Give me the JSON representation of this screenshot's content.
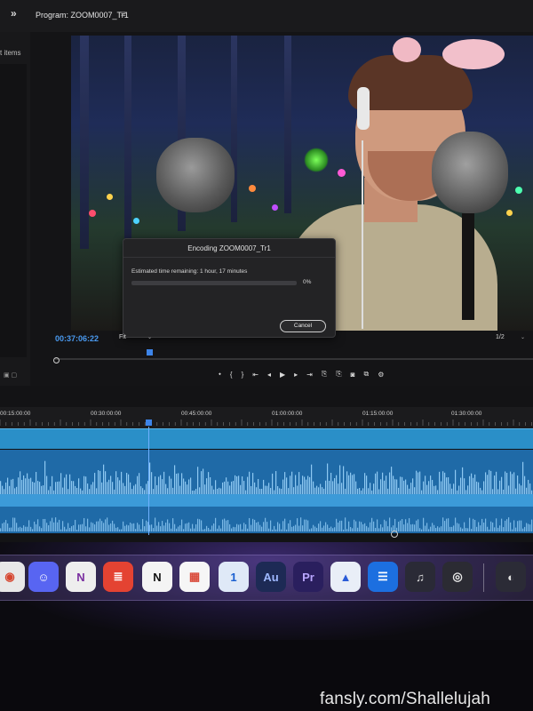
{
  "program_panel": {
    "collapse_glyph": "»",
    "title": "Program: ZOOM0007_Tr1",
    "menu_glyph": "≡"
  },
  "project_panel": {
    "items_label": "t items"
  },
  "encoding_dialog": {
    "title": "Encoding ZOOM0007_Tr1",
    "estimated_time": "Estimated time remaining: 1 hour, 17 minutes",
    "progress_percent": 0,
    "percent_label": "0%",
    "cancel_label": "Cancel"
  },
  "monitor": {
    "timecode": "00:37:06:22",
    "fit_label": "Fit",
    "resolution_label": "1/2",
    "chevron": "⌄"
  },
  "transport": {
    "buttons": [
      "⬩",
      "{",
      "}",
      "⇤",
      "◂",
      "▶",
      "▸",
      "⇥",
      "⎘",
      "⎘",
      "◙",
      "⧉",
      "⚙"
    ]
  },
  "timeline": {
    "ruler_labels": [
      "00:15:00:00",
      "00:30:00:00",
      "00:45:00:00",
      "01:00:00:00",
      "01:15:00:00",
      "01:30:00:00"
    ]
  },
  "dock": {
    "apps": [
      {
        "name": "chrome",
        "glyph": "◉",
        "bg": "#e8e8e8",
        "fg": "#d6452f"
      },
      {
        "name": "discord",
        "glyph": "☺",
        "bg": "#5865f2",
        "fg": "#ffffff"
      },
      {
        "name": "onenote",
        "glyph": "N",
        "bg": "#eeeeee",
        "fg": "#7a2ea0"
      },
      {
        "name": "todoist",
        "glyph": "≣",
        "bg": "#e44332",
        "fg": "#ffffff"
      },
      {
        "name": "notion",
        "glyph": "N",
        "bg": "#f4f4f4",
        "fg": "#111111"
      },
      {
        "name": "calendar",
        "glyph": "▦",
        "bg": "#f6f6f6",
        "fg": "#d94a3a"
      },
      {
        "name": "1password",
        "glyph": "1",
        "bg": "#dfe9f7",
        "fg": "#1a5fd0"
      },
      {
        "name": "audition",
        "glyph": "Au",
        "bg": "#1d2a55",
        "fg": "#9fb8ff"
      },
      {
        "name": "premiere",
        "glyph": "Pr",
        "bg": "#2a1f5e",
        "fg": "#b9a6ff"
      },
      {
        "name": "nordvpn",
        "glyph": "▲",
        "bg": "#e9eef7",
        "fg": "#2a5bd7"
      },
      {
        "name": "stream-tool",
        "glyph": "☰",
        "bg": "#1c6fe0",
        "fg": "#ffffff"
      },
      {
        "name": "ua-console",
        "glyph": "♫",
        "bg": "#2a2a36",
        "fg": "#e0e0e0"
      },
      {
        "name": "obs",
        "glyph": "◎",
        "bg": "#2b2b33",
        "fg": "#e8e8e8"
      },
      {
        "name": "ua-connect",
        "glyph": "◐",
        "bg": "#2b2b36",
        "fg": "#e0e0e0"
      }
    ]
  },
  "watermark": "fansly.com/Shallelujah"
}
